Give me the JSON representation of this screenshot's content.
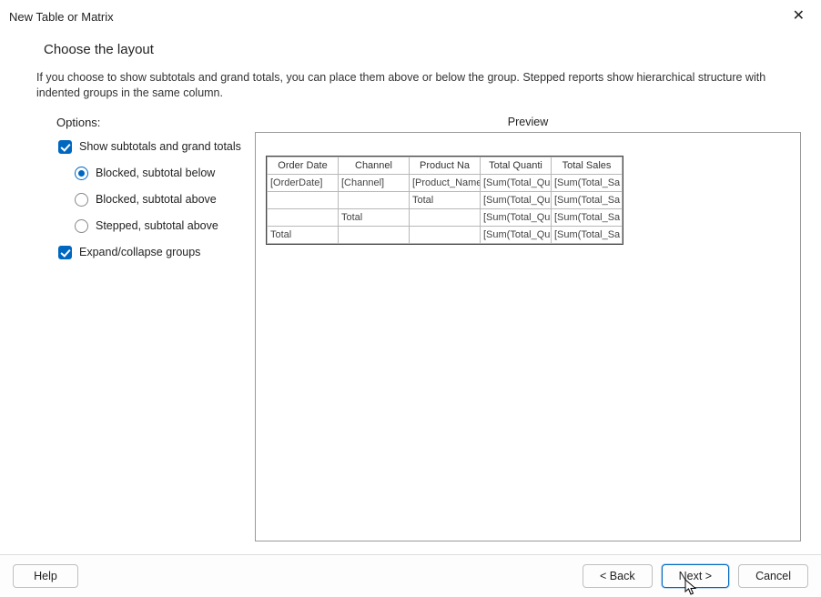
{
  "window": {
    "title": "New Table or Matrix"
  },
  "page": {
    "heading": "Choose the layout",
    "description": "If you choose to show subtotals and grand totals, you can place them above or below the group. Stepped reports show hierarchical structure with indented groups in the same column."
  },
  "options": {
    "label": "Options:",
    "show_totals": "Show subtotals and grand totals",
    "radios": {
      "blocked_below": "Blocked, subtotal below",
      "blocked_above": "Blocked, subtotal above",
      "stepped_above": "Stepped, subtotal above"
    },
    "expand_collapse": "Expand/collapse groups"
  },
  "preview": {
    "label": "Preview",
    "headers": [
      "Order Date",
      "Channel",
      "Product Na",
      "Total Quanti",
      "Total Sales"
    ],
    "rows": [
      [
        "[OrderDate]",
        "[Channel]",
        "[Product_Name]",
        "[Sum(Total_Qu",
        "[Sum(Total_Sa"
      ],
      [
        "",
        "",
        "Total",
        "[Sum(Total_Qu",
        "[Sum(Total_Sa"
      ],
      [
        "",
        "Total",
        "",
        "[Sum(Total_Qu",
        "[Sum(Total_Sa"
      ],
      [
        "Total",
        "",
        "",
        "[Sum(Total_Qu",
        "[Sum(Total_Sa"
      ]
    ]
  },
  "buttons": {
    "help": "Help",
    "back": "< Back",
    "next": "Next >",
    "cancel": "Cancel"
  }
}
